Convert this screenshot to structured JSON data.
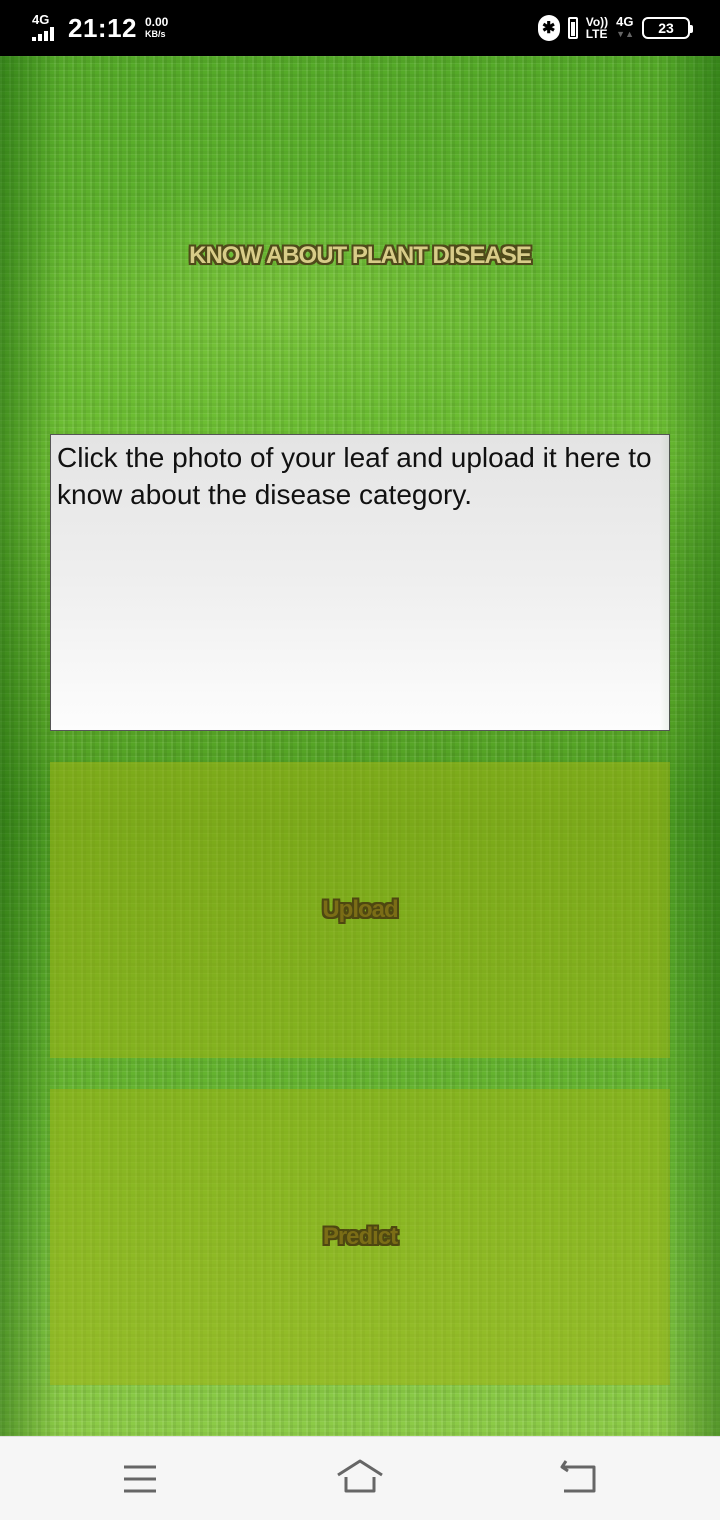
{
  "status_bar": {
    "network": "4G",
    "time": "21:12",
    "speed_value": "0.00",
    "speed_unit": "KB/s",
    "volte_top": "Vo))",
    "volte_bottom": "LTE",
    "network2": "4G",
    "network2_sub": "▼▲",
    "bluetooth_glyph": "✱",
    "battery_level": "23"
  },
  "app": {
    "title": "KNOW ABOUT PLANT DISEASE",
    "info_text": "Click the photo of your leaf and upload it here to know about the disease category.",
    "upload_label": "Upload",
    "predict_label": "Predict"
  },
  "nav": {
    "icons": [
      "menu-icon",
      "home-icon",
      "back-icon"
    ]
  },
  "colors": {
    "background_green": "#5fb828",
    "title_fill": "#d8cc88",
    "panel_overlay": "#a0b414",
    "label_fill": "#7b6d16"
  }
}
